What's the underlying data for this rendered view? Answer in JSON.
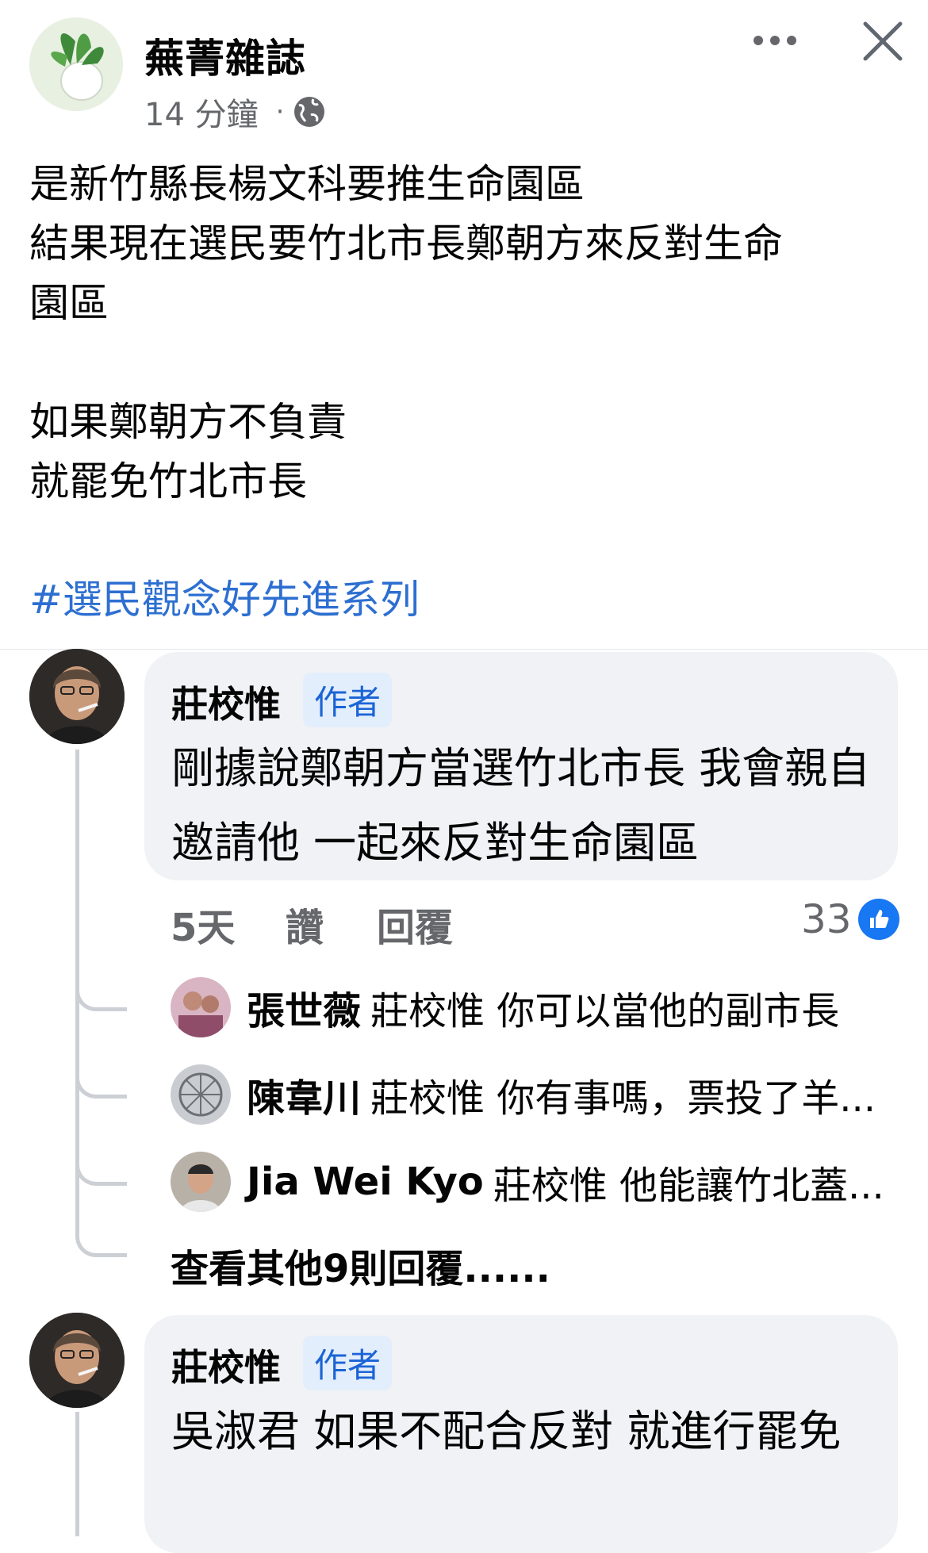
{
  "post": {
    "page_name": "蕪菁雜誌",
    "time": "14 分鐘",
    "dot": "·",
    "lines": [
      "是新竹縣長楊文科要推生命園區\n結果現在選民要竹北市長鄭朝方來反對生命\n園區",
      "如果鄭朝方不負責\n就罷免竹北市長"
    ],
    "hashtag": "#選民觀念好先進系列"
  },
  "comment1": {
    "author": "莊校惟",
    "badge": "作者",
    "text": "剛據說鄭朝方當選竹北市長 我會親自邀請他 一起來反對生命園區",
    "time": "5天",
    "like": "讚",
    "reply": "回覆",
    "like_count": "33",
    "replies": [
      {
        "name": "張世薇",
        "text": "莊校惟 你可以當他的副市長"
      },
      {
        "name": "陳韋川",
        "text": "莊校惟 你有事嗎，票投了羊..."
      },
      {
        "name": "Jia Wei  Kyo",
        "text": "莊校惟 他能讓竹北蓋..."
      }
    ],
    "more_replies": "查看其他9則回覆......"
  },
  "comment2": {
    "author": "莊校惟",
    "badge": "作者",
    "text": "吳淑君 如果不配合反對 就進行罷免"
  },
  "icons": {
    "globe": "globe-icon",
    "more": "more-horizontal-icon",
    "close": "close-icon",
    "like": "thumbs-up-icon"
  },
  "colors": {
    "hashtag": "#2d6fd1",
    "badge_text": "#1b64d6",
    "badge_bg": "#e3eefc",
    "bubble_bg": "#f0f2f5",
    "like_blue": "#1877f2",
    "secondary_text": "#65676b"
  }
}
